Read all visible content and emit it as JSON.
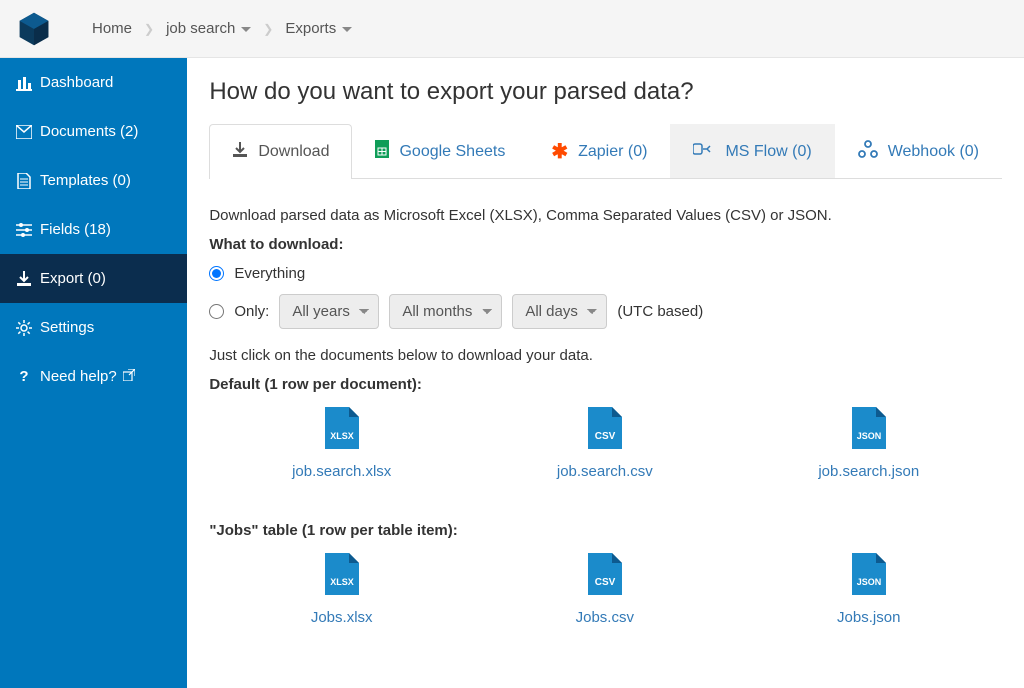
{
  "breadcrumb": {
    "home": "Home",
    "item1": "job search",
    "item2": "Exports"
  },
  "sidebar": {
    "dashboard": "Dashboard",
    "documents": "Documents (2)",
    "templates": "Templates (0)",
    "fields": "Fields (18)",
    "export": "Export (0)",
    "settings": "Settings",
    "help": "Need help?"
  },
  "main": {
    "title": "How do you want to export your parsed data?",
    "tabs": {
      "download": "Download",
      "sheets": "Google Sheets",
      "zapier": "Zapier (0)",
      "msflow": "MS Flow (0)",
      "webhook": "Webhook (0)"
    },
    "desc": "Download parsed data as Microsoft Excel (XLSX), Comma Separated Values (CSV) or JSON.",
    "what": "What to download:",
    "everything": "Everything",
    "only": "Only:",
    "years": "All years",
    "months": "All months",
    "days": "All days",
    "utc": "(UTC based)",
    "instr": "Just click on the documents below to download your data.",
    "default_title": "Default (1 row per document):",
    "default": {
      "xlsx": "job.search.xlsx",
      "csv": "job.search.csv",
      "json": "job.search.json"
    },
    "table_title": "\"Jobs\" table (1 row per table item):",
    "jobs": {
      "xlsx": "Jobs.xlsx",
      "csv": "Jobs.csv",
      "json": "Jobs.json"
    }
  }
}
